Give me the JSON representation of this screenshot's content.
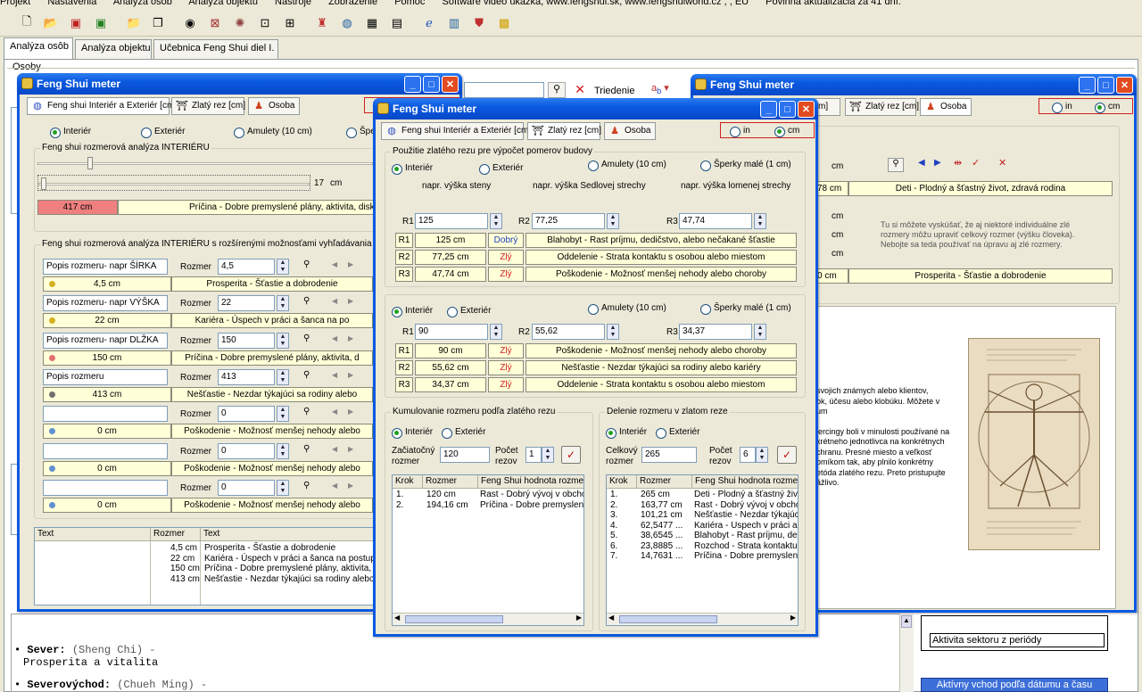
{
  "menu": [
    "Projekt",
    "Nastavenia",
    "Analýza osôb",
    "Analýza objektu",
    "Nástroje",
    "Zobrazenie",
    "Pomoc",
    "Software video ukážka, www.fengshui.sk, www.fengshuiworld.cz , , EU",
    "Povinná aktualizácia za 41 dní."
  ],
  "main_tabs": [
    "Analýza osôb",
    "Analýza objektu",
    "Učebnica Feng Shui diel I."
  ],
  "osoby_label": "Osoby",
  "triedenie": "Triedenie",
  "bullets": [
    {
      "name": "Sever:",
      "pinyin": "(Sheng Chi) -",
      "text": "Prosperita a vitalita"
    },
    {
      "name": "Severovýchod:",
      "pinyin": "(Chueh Ming) -",
      "text": ""
    }
  ],
  "aktivita": "Aktivita sektoru z periódy",
  "aktivny_vchod": "Aktívny vchod podľa dátumu a času",
  "win_title": "Feng Shui meter",
  "subtabs": [
    "Feng shui Interiér a Exteriér [cm]",
    "Zlatý rez [cm]",
    "Osoba"
  ],
  "units": {
    "in": "in",
    "cm": "cm"
  },
  "w1": {
    "radios": [
      "Interiér",
      "Exteriér",
      "Amulety (10 cm)",
      "Šper"
    ],
    "grp1": "Feng shui rozmerová analýza INTERIÉRU",
    "slider_val": "17",
    "slider_unit": "cm",
    "res_val": "417 cm",
    "res_text": "Príčina - Dobre premyslené plány, aktivita, diskusia",
    "grp2": "Feng shui rozmerová analýza INTERIÉRU s rozšírenými možnosťami vyhľadávania priaznivých rozmerov",
    "rozmer_label": "Rozmer",
    "rows": [
      {
        "desc": "Popis rozmeru- napr ŠÍRKA",
        "val": "4,5",
        "res": "4,5 cm",
        "text": "Prosperita - Šťastie a dobrodenie",
        "color": "#d4b020"
      },
      {
        "desc": "Popis rozmeru- napr VÝŠKA",
        "val": "22",
        "res": "22 cm",
        "text": "Kariéra - Úspech v práci a šanca na po",
        "color": "#d4b020"
      },
      {
        "desc": "Popis rozmeru- napr DLŽKA",
        "val": "150",
        "res": "150 cm",
        "text": "Príčina - Dobre premyslené plány, aktivita, d",
        "color": "#e07070"
      },
      {
        "desc": "Popis rozmeru",
        "val": "413",
        "res": "413 cm",
        "text": "Nešťastie - Nezdar týkajúci sa rodiny alebo",
        "color": "#707070"
      },
      {
        "desc": "",
        "val": "0",
        "res": "0 cm",
        "text": "Poškodenie - Možnosť menšej nehody alebo",
        "color": "#6090d0"
      },
      {
        "desc": "",
        "val": "0",
        "res": "0 cm",
        "text": "Poškodenie - Možnosť menšej nehody alebo",
        "color": "#6090d0"
      },
      {
        "desc": "",
        "val": "0",
        "res": "0 cm",
        "text": "Poškodenie - Možnosť menšej nehody alebo",
        "color": "#6090d0"
      }
    ],
    "list_cols": [
      "Text",
      "Rozmer",
      "Text"
    ],
    "list_rows": [
      {
        "r": "4,5 cm",
        "t": "Prosperita - Šťastie a dobrodenie"
      },
      {
        "r": "22 cm",
        "t": "Kariéra - Úspech v práci a šanca na postup"
      },
      {
        "r": "150 cm",
        "t": "Príčina - Dobre premyslené plány, aktivita, di"
      },
      {
        "r": "413 cm",
        "t": "Nešťastie - Nezdar týkajúci sa rodiny alebo ka"
      }
    ]
  },
  "w2": {
    "grp1": "Použitie zlatého rezu pre výpočet pomerov budovy",
    "radios1": [
      "Interiér",
      "Exteriér",
      "Amulety (10 cm)",
      "Šperky malé (1 cm)"
    ],
    "h1": "napr. výška steny",
    "h2": "napr. výška Sedlovej strechy",
    "h3": "napr. výška lomenej strechy",
    "labels": [
      "R1",
      "R2",
      "R3"
    ],
    "inputs1": [
      "125",
      "77,25",
      "47,74"
    ],
    "res1": [
      {
        "v": "125 cm",
        "q": "Dobrý",
        "t": "Blahobyt - Rast príjmu, dedičstvo, alebo nečakané šťastie"
      },
      {
        "v": "77,25 cm",
        "q": "Zlý",
        "t": "Oddelenie - Strata kontaktu s osobou alebo miestom"
      },
      {
        "v": "47,74 cm",
        "q": "Zlý",
        "t": "Poškodenie - Možnosť menšej nehody alebo choroby"
      }
    ],
    "radios2": [
      "Interiér",
      "Exteriér",
      "Amulety (10 cm)",
      "Šperky malé (1 cm)"
    ],
    "inputs2": [
      "90",
      "55,62",
      "34,37"
    ],
    "res2": [
      {
        "v": "90 cm",
        "q": "Zlý",
        "t": "Poškodenie - Možnosť menšej nehody alebo choroby"
      },
      {
        "v": "55,62 cm",
        "q": "Zlý",
        "t": "Nešťastie - Nezdar týkajúci sa rodiny alebo kariéry"
      },
      {
        "v": "34,37 cm",
        "q": "Zlý",
        "t": "Oddelenie - Strata kontaktu s osobou alebo miestom"
      }
    ],
    "kum": {
      "title": "Kumulovanie rozmeru podľa zlatého rezu",
      "radios": [
        "Interiér",
        "Exteriér"
      ],
      "l1": "Začiatočný",
      "l1b": "rozmer",
      "v1": "120",
      "l2": "Počet",
      "l2b": "rezov",
      "v2": "1",
      "cols": [
        "Krok",
        "Rozmer",
        "Feng Shui hodnota rozmeru"
      ],
      "rows": [
        {
          "k": "1.",
          "r": "120 cm",
          "t": "Rast - Dobrý vývoj v obcho"
        },
        {
          "k": "2.",
          "r": "194,16 cm",
          "t": "Príčina - Dobre premyslené"
        }
      ]
    },
    "del": {
      "title": "Delenie rozmeru v zlatom reze",
      "radios": [
        "Interiér",
        "Exteriér"
      ],
      "l1": "Celkový",
      "l1b": "rozmer",
      "v1": "265",
      "l2": "Počet",
      "l2b": "rezov",
      "v2": "6",
      "cols": [
        "Krok",
        "Rozmer",
        "Feng Shui hodnota rozmeru"
      ],
      "rows": [
        {
          "k": "1.",
          "r": "265 cm",
          "t": "Deti - Plodný a šťastný život"
        },
        {
          "k": "2.",
          "r": "163,77 cm",
          "t": "Rast - Dobrý vývoj v obcho"
        },
        {
          "k": "3.",
          "r": "101,21 cm",
          "t": "Nešťastie - Nezdar týkajúci"
        },
        {
          "k": "4.",
          "r": "62,5477 ...",
          "t": "Kariéra - Úspech v práci a š"
        },
        {
          "k": "5.",
          "r": "38,6545 ...",
          "t": "Blahobyt - Rast príjmu, dedi"
        },
        {
          "k": "6.",
          "r": "23,8885 ...",
          "t": "Rozchod - Strata kontaktu s"
        },
        {
          "k": "7.",
          "r": "14,7631 ...",
          "t": "Príčina - Dobre premyslené"
        }
      ]
    }
  },
  "w3": {
    "res_top": "78 cm",
    "res_top_text": "Deti - Plodný a šťastný život, zdravá rodina",
    "info": "Tu si môžete vyskúšať, že aj niektoré individuálne zlé rozmery môžu upraviť celkový rozmer (výšku človeka). Nebojte sa teda používať na úpravu aj zlé rozmery.",
    "res_bottom": "0 cm",
    "res_bottom_text": "Prosperita - Šťastie a dobrodenie",
    "cm": "cm",
    "lines": [
      "svojich známych alebo klientov,",
      "ok, účesu alebo klobúku. Môžete v",
      "um",
      "",
      "iercingy boli v minulosti používané na",
      "krétneho jednotlivca na konkrétnych",
      "chranu. Presné miesto a veľkosť",
      "omíkom tak, aby plnilo konkrétny",
      "etóda zlatého rezu. Preto pristupujte",
      "ážlivo."
    ]
  }
}
